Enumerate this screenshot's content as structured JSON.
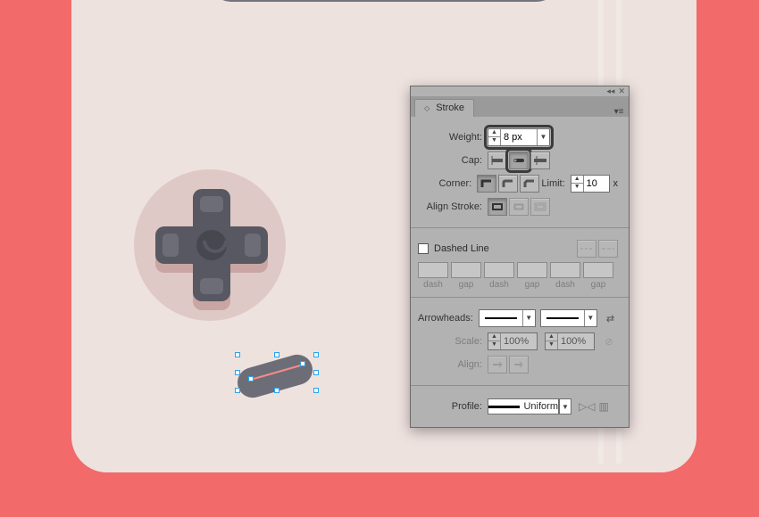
{
  "panel": {
    "title": "Stroke",
    "weight": {
      "label": "Weight:",
      "value": "8 px"
    },
    "cap": {
      "label": "Cap:"
    },
    "corner": {
      "label": "Corner:",
      "limit_label": "Limit:",
      "limit_value": "10",
      "limit_suffix": "x"
    },
    "align": {
      "label": "Align Stroke:"
    },
    "dashed": {
      "label": "Dashed Line",
      "cols": [
        "dash",
        "gap",
        "dash",
        "gap",
        "dash",
        "gap"
      ]
    },
    "arrowheads": {
      "label": "Arrowheads:"
    },
    "scale": {
      "label": "Scale:",
      "value1": "100%",
      "value2": "100%"
    },
    "align_arrow": {
      "label": "Align:"
    },
    "profile": {
      "label": "Profile:",
      "value": "Uniform"
    }
  }
}
